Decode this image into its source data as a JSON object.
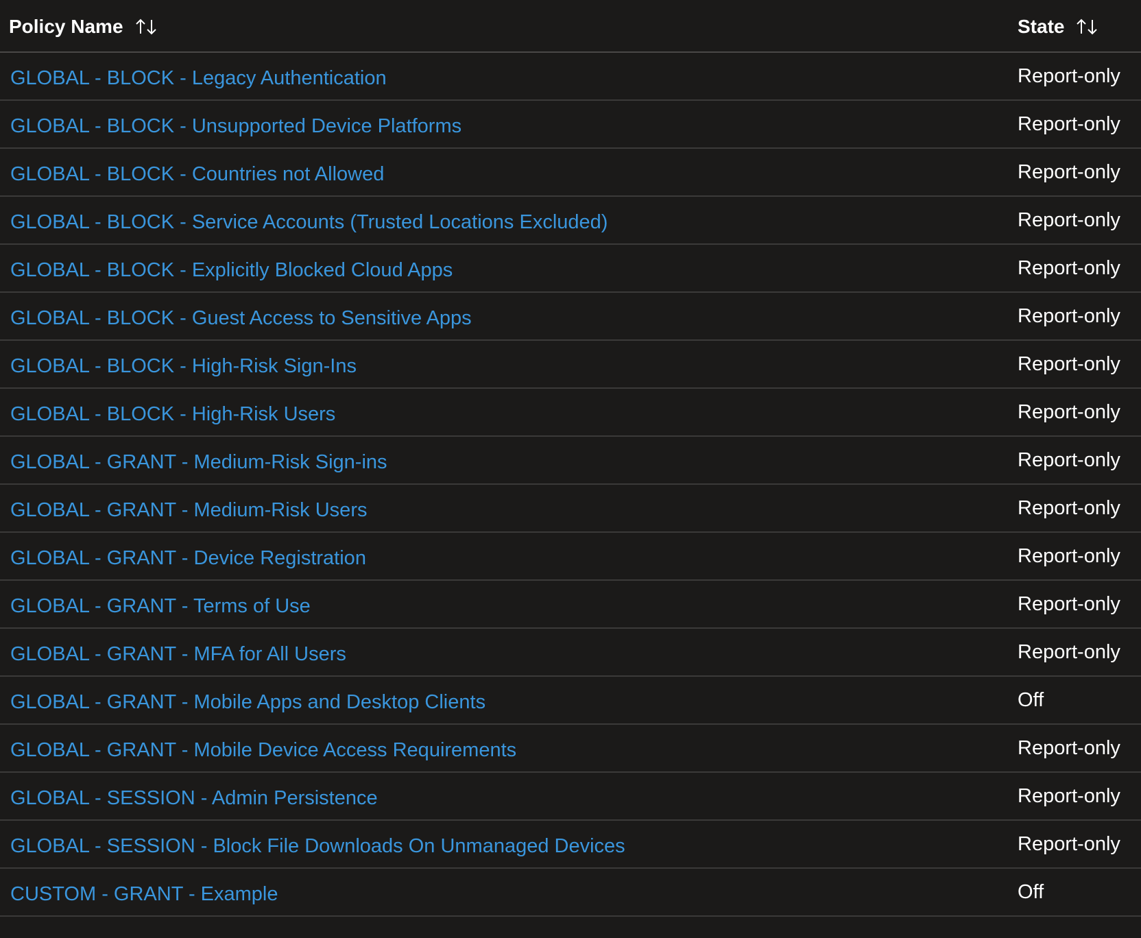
{
  "table": {
    "columns": {
      "name_header": "Policy Name",
      "state_header": "State",
      "sort_icon": "sort-up-down-icon"
    },
    "colors": {
      "background": "#1b1a19",
      "link": "#3a96dd",
      "text": "#ffffff",
      "divider": "#3b3a39"
    },
    "rows": [
      {
        "name": "GLOBAL - BLOCK - Legacy Authentication",
        "state": "Report-only"
      },
      {
        "name": "GLOBAL - BLOCK - Unsupported Device Platforms",
        "state": "Report-only"
      },
      {
        "name": "GLOBAL - BLOCK - Countries not Allowed",
        "state": "Report-only"
      },
      {
        "name": "GLOBAL - BLOCK - Service Accounts (Trusted Locations Excluded)",
        "state": "Report-only"
      },
      {
        "name": "GLOBAL - BLOCK - Explicitly Blocked Cloud Apps",
        "state": "Report-only"
      },
      {
        "name": "GLOBAL - BLOCK - Guest Access to Sensitive Apps",
        "state": "Report-only"
      },
      {
        "name": "GLOBAL - BLOCK - High-Risk Sign-Ins",
        "state": "Report-only"
      },
      {
        "name": "GLOBAL - BLOCK - High-Risk Users",
        "state": "Report-only"
      },
      {
        "name": "GLOBAL - GRANT - Medium-Risk Sign-ins",
        "state": "Report-only"
      },
      {
        "name": "GLOBAL - GRANT - Medium-Risk Users",
        "state": "Report-only"
      },
      {
        "name": "GLOBAL - GRANT - Device Registration",
        "state": "Report-only"
      },
      {
        "name": "GLOBAL - GRANT - Terms of Use",
        "state": "Report-only"
      },
      {
        "name": "GLOBAL - GRANT - MFA for All Users",
        "state": "Report-only"
      },
      {
        "name": "GLOBAL - GRANT - Mobile Apps and Desktop Clients",
        "state": "Off"
      },
      {
        "name": "GLOBAL - GRANT - Mobile Device Access Requirements",
        "state": "Report-only"
      },
      {
        "name": "GLOBAL - SESSION - Admin Persistence",
        "state": "Report-only"
      },
      {
        "name": "GLOBAL - SESSION - Block File Downloads On Unmanaged Devices",
        "state": "Report-only"
      },
      {
        "name": "CUSTOM - GRANT - Example",
        "state": "Off"
      }
    ]
  }
}
